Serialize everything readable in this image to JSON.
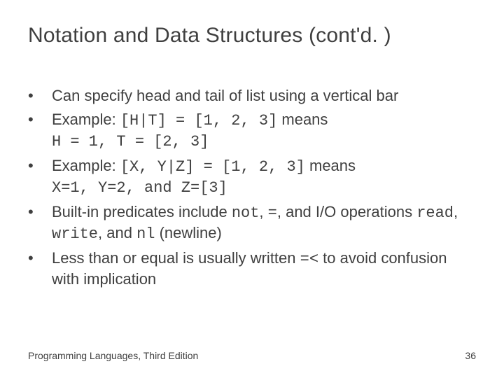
{
  "title": "Notation and Data Structures (cont'd. )",
  "bullets": [
    {
      "type": "plain",
      "text": "Can specify head and tail of list using a vertical bar"
    },
    {
      "type": "ex1",
      "pre": "Example: ",
      "code1": "[H|T] = [1, 2, 3]",
      "mid": " means ",
      "code2": "H = 1, T = [2, 3]"
    },
    {
      "type": "ex2",
      "pre": "Example: ",
      "code1": "[X, Y|Z] = [1, 2, 3]",
      "mid": " means ",
      "code2": "X=1, Y=2, and Z=[3]"
    },
    {
      "type": "builtin",
      "a": "Built-in predicates include ",
      "c1": "not",
      "b": ", ",
      "c2": "=",
      "c": ", and I/O operations ",
      "c3": "read",
      "d": ", ",
      "c4": "write",
      "e": ", and ",
      "c5": "nl",
      "f": " (newline)"
    },
    {
      "type": "leq",
      "a": "Less than or equal is usually written ",
      "c1": "=<",
      "b": " to avoid confusion with implication"
    }
  ],
  "footer": {
    "left": "Programming Languages, Third Edition",
    "right": "36"
  }
}
